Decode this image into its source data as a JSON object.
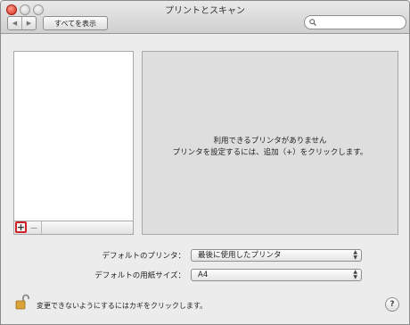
{
  "window": {
    "title": "プリントとスキャン"
  },
  "toolbar": {
    "back_icon": "◀",
    "forward_icon": "▶",
    "show_all_label": "すべてを表示",
    "search_placeholder": "",
    "search_icon": "search-icon"
  },
  "printer_list": {
    "items": [],
    "add_label": "+",
    "remove_label": "−"
  },
  "detail": {
    "line1": "利用できるプリンタがありません",
    "line2": "プリンタを設定するには、追加（+）をクリックします。"
  },
  "defaults": {
    "printer_label": "デフォルトのプリンタ：",
    "printer_value": "最後に使用したプリンタ",
    "paper_label": "デフォルトの用紙サイズ：",
    "paper_value": "A4"
  },
  "footer": {
    "lock_text": "変更できないようにするにはカギをクリックします。",
    "help_label": "?"
  },
  "colors": {
    "highlight_border": "#d0202a",
    "panel_bg": "#dedede",
    "window_bg": "#ececec"
  }
}
